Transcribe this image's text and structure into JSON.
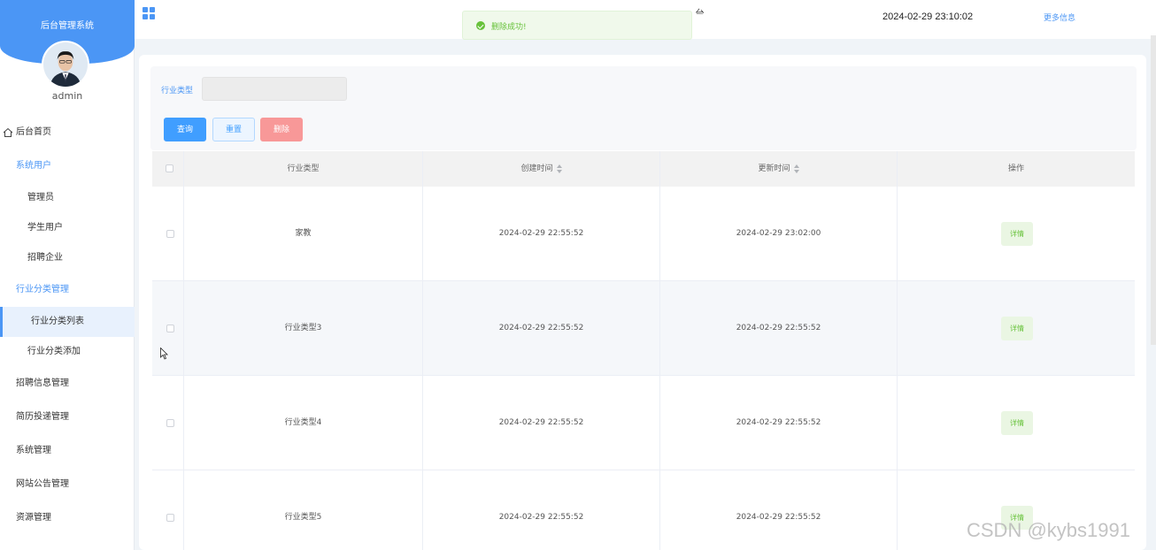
{
  "sidebar": {
    "title": "后台管理系统",
    "username": "admin",
    "items": [
      {
        "label": "后台首页"
      },
      {
        "label": "系统用户"
      },
      {
        "label": "管理员"
      },
      {
        "label": "学生用户"
      },
      {
        "label": "招聘企业"
      },
      {
        "label": "行业分类管理"
      },
      {
        "label": "行业分类列表"
      },
      {
        "label": "行业分类添加"
      },
      {
        "label": "招聘信息管理"
      },
      {
        "label": "简历投递管理"
      },
      {
        "label": "系统管理"
      },
      {
        "label": "网站公告管理"
      },
      {
        "label": "资源管理"
      }
    ]
  },
  "topbar": {
    "datetime": "2024-02-29 23:10:02",
    "more_info": "更多信息",
    "title_partial": "台"
  },
  "toast": {
    "message": "删除成功!"
  },
  "filter": {
    "label": "行业类型",
    "value": ""
  },
  "buttons": {
    "query": "查询",
    "reset": "重置",
    "delete": "删除"
  },
  "table": {
    "headers": {
      "type": "行业类型",
      "created": "创建时间",
      "updated": "更新时间",
      "action": "操作"
    },
    "rows": [
      {
        "type": "家教",
        "created": "2024-02-29 22:55:52",
        "updated": "2024-02-29 23:02:00",
        "action": "详情"
      },
      {
        "type": "行业类型3",
        "created": "2024-02-29 22:55:52",
        "updated": "2024-02-29 22:55:52",
        "action": "详情"
      },
      {
        "type": "行业类型4",
        "created": "2024-02-29 22:55:52",
        "updated": "2024-02-29 22:55:52",
        "action": "详情"
      },
      {
        "type": "行业类型5",
        "created": "2024-02-29 22:55:52",
        "updated": "2024-02-29 22:55:52",
        "action": "详情"
      }
    ]
  },
  "watermark": "CSDN @kybs1991",
  "colors": {
    "primary": "#409eff",
    "sidebar_header": "#4b96f5",
    "success": "#67c23a",
    "danger": "#f89898"
  }
}
